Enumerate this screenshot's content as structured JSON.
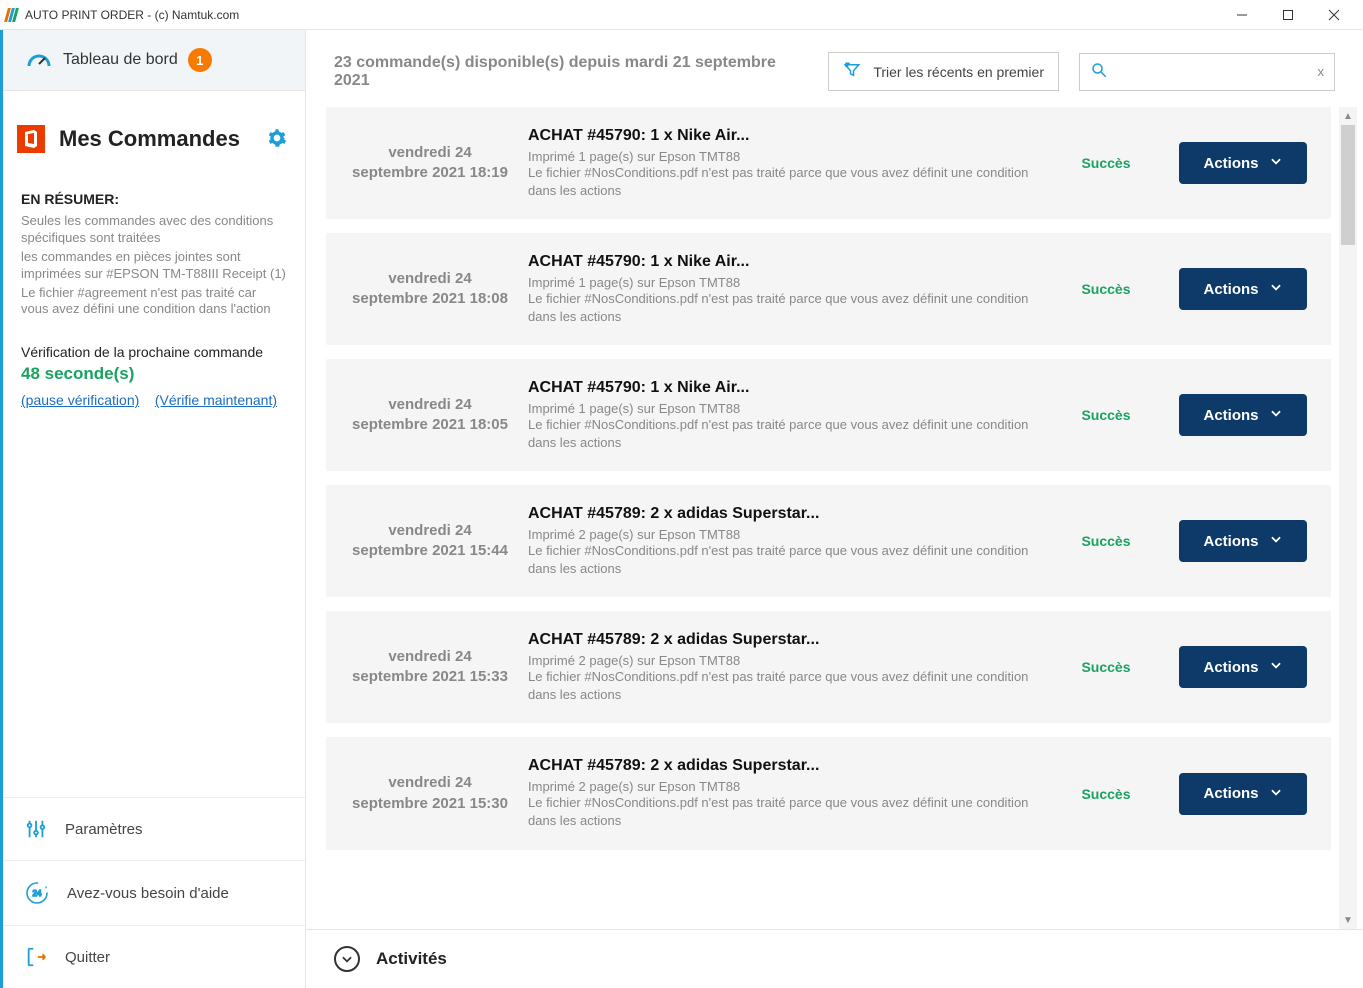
{
  "window": {
    "title": "AUTO PRINT ORDER - (c) Namtuk.com"
  },
  "sidebar": {
    "dashboard_label": "Tableau de bord",
    "badge_count": "1",
    "orders_heading": "Mes Commandes",
    "summary_label": "EN RÉSUMER:",
    "summary_line1": "Seules les commandes avec des conditions spécifiques sont traitées",
    "summary_line2": "les commandes en pièces jointes sont imprimées sur #EPSON TM-T88III Receipt (1)",
    "summary_line3": "Le fichier #agreement n'est pas traité car vous avez défini une condition dans l'action",
    "verify_title": "Vérification de la prochaine commande",
    "verify_seconds": "48 seconde(s)",
    "pause_link": "(pause vérification)",
    "verify_now_link": "(Vérifie maintenant)",
    "footer": {
      "settings": "Paramètres",
      "help": "Avez-vous besoin d'aide",
      "quit": "Quitter"
    }
  },
  "top": {
    "summary": "23 commande(s) disponible(s) depuis mardi 21 septembre 2021",
    "sort_label": "Trier les récents en premier"
  },
  "search": {
    "placeholder": "",
    "clear_label": "x"
  },
  "actions_label": "Actions",
  "orders": [
    {
      "date": "vendredi 24 septembre 2021 18:19",
      "title": "ACHAT #45790: 1 x Nike Air...",
      "line1": "Imprimé 1 page(s) sur Epson TMT88",
      "line2": "Le fichier #NosConditions.pdf n'est pas traité parce que vous avez définit une condition dans les actions",
      "status": "Succès"
    },
    {
      "date": "vendredi 24 septembre 2021 18:08",
      "title": "ACHAT #45790: 1 x Nike Air...",
      "line1": "Imprimé 1 page(s) sur Epson TMT88",
      "line2": "Le fichier #NosConditions.pdf n'est pas traité parce que vous avez définit une condition dans les actions",
      "status": "Succès"
    },
    {
      "date": "vendredi 24 septembre 2021 18:05",
      "title": "ACHAT #45790: 1 x Nike Air...",
      "line1": "Imprimé 1 page(s) sur Epson TMT88",
      "line2": "Le fichier #NosConditions.pdf n'est pas traité parce que vous avez définit une condition dans les actions",
      "status": "Succès"
    },
    {
      "date": "vendredi 24 septembre 2021 15:44",
      "title": "ACHAT #45789: 2 x adidas Superstar...",
      "line1": "Imprimé 2 page(s) sur Epson TMT88",
      "line2": "Le fichier #NosConditions.pdf n'est pas traité parce que vous avez définit une condition dans les actions",
      "status": "Succès"
    },
    {
      "date": "vendredi 24 septembre 2021 15:33",
      "title": "ACHAT #45789: 2 x adidas Superstar...",
      "line1": "Imprimé 2 page(s) sur Epson TMT88",
      "line2": "Le fichier #NosConditions.pdf n'est pas traité parce que vous avez définit une condition dans les actions",
      "status": "Succès"
    },
    {
      "date": "vendredi 24 septembre 2021 15:30",
      "title": "ACHAT #45789: 2 x adidas Superstar...",
      "line1": "Imprimé 2 page(s) sur Epson TMT88",
      "line2": "Le fichier #NosConditions.pdf n'est pas traité parce que vous avez définit une condition dans les actions",
      "status": "Succès"
    }
  ],
  "bottom": {
    "activities": "Activités"
  }
}
